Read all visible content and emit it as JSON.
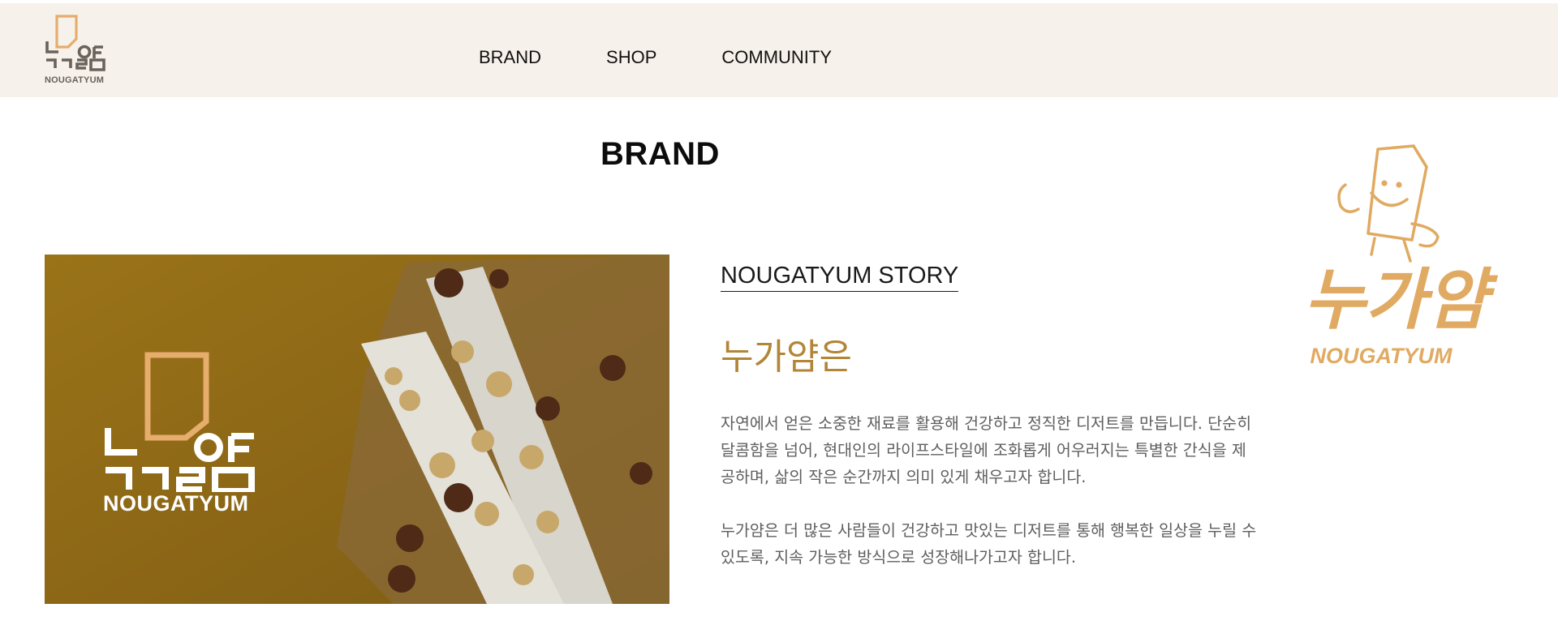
{
  "header": {
    "logo_text": "NOUGATYUM",
    "nav": [
      "BRAND",
      "SHOP",
      "COMMUNITY"
    ]
  },
  "page": {
    "title": "BRAND"
  },
  "hero": {
    "logo_text": "NOUGATYUM"
  },
  "story": {
    "heading": "NOUGATYUM STORY",
    "subheading": "누가얌은",
    "paragraph1_lines": [
      "자연에서 얻은 소중한 재료를 활용해 건강하고 정직한 디저트를 만듭니다. 단순히",
      "달콤함을 넘어, 현대인의 라이프스타일에 조화롭게 어우러지는 특별한 간식을 제",
      "공하며, 삶의 작은 순간까지 의미 있게 채우고자 합니다."
    ],
    "paragraph2_lines": [
      "누가얌은 더 많은 사람들이 건강하고 맛있는 디저트를 통해 행복한 일상을 누릴 수",
      "있도록, 지속 가능한 방식으로 성장해나가고자 합니다."
    ]
  },
  "mascot": {
    "wordmark": "NOUGATYUM",
    "korean_mark": "누가얌"
  },
  "colors": {
    "header_bg": "#f6f1ea",
    "accent": "#b28537",
    "mascot": "#e0aa62",
    "logo_orange": "#e6ad6c"
  }
}
